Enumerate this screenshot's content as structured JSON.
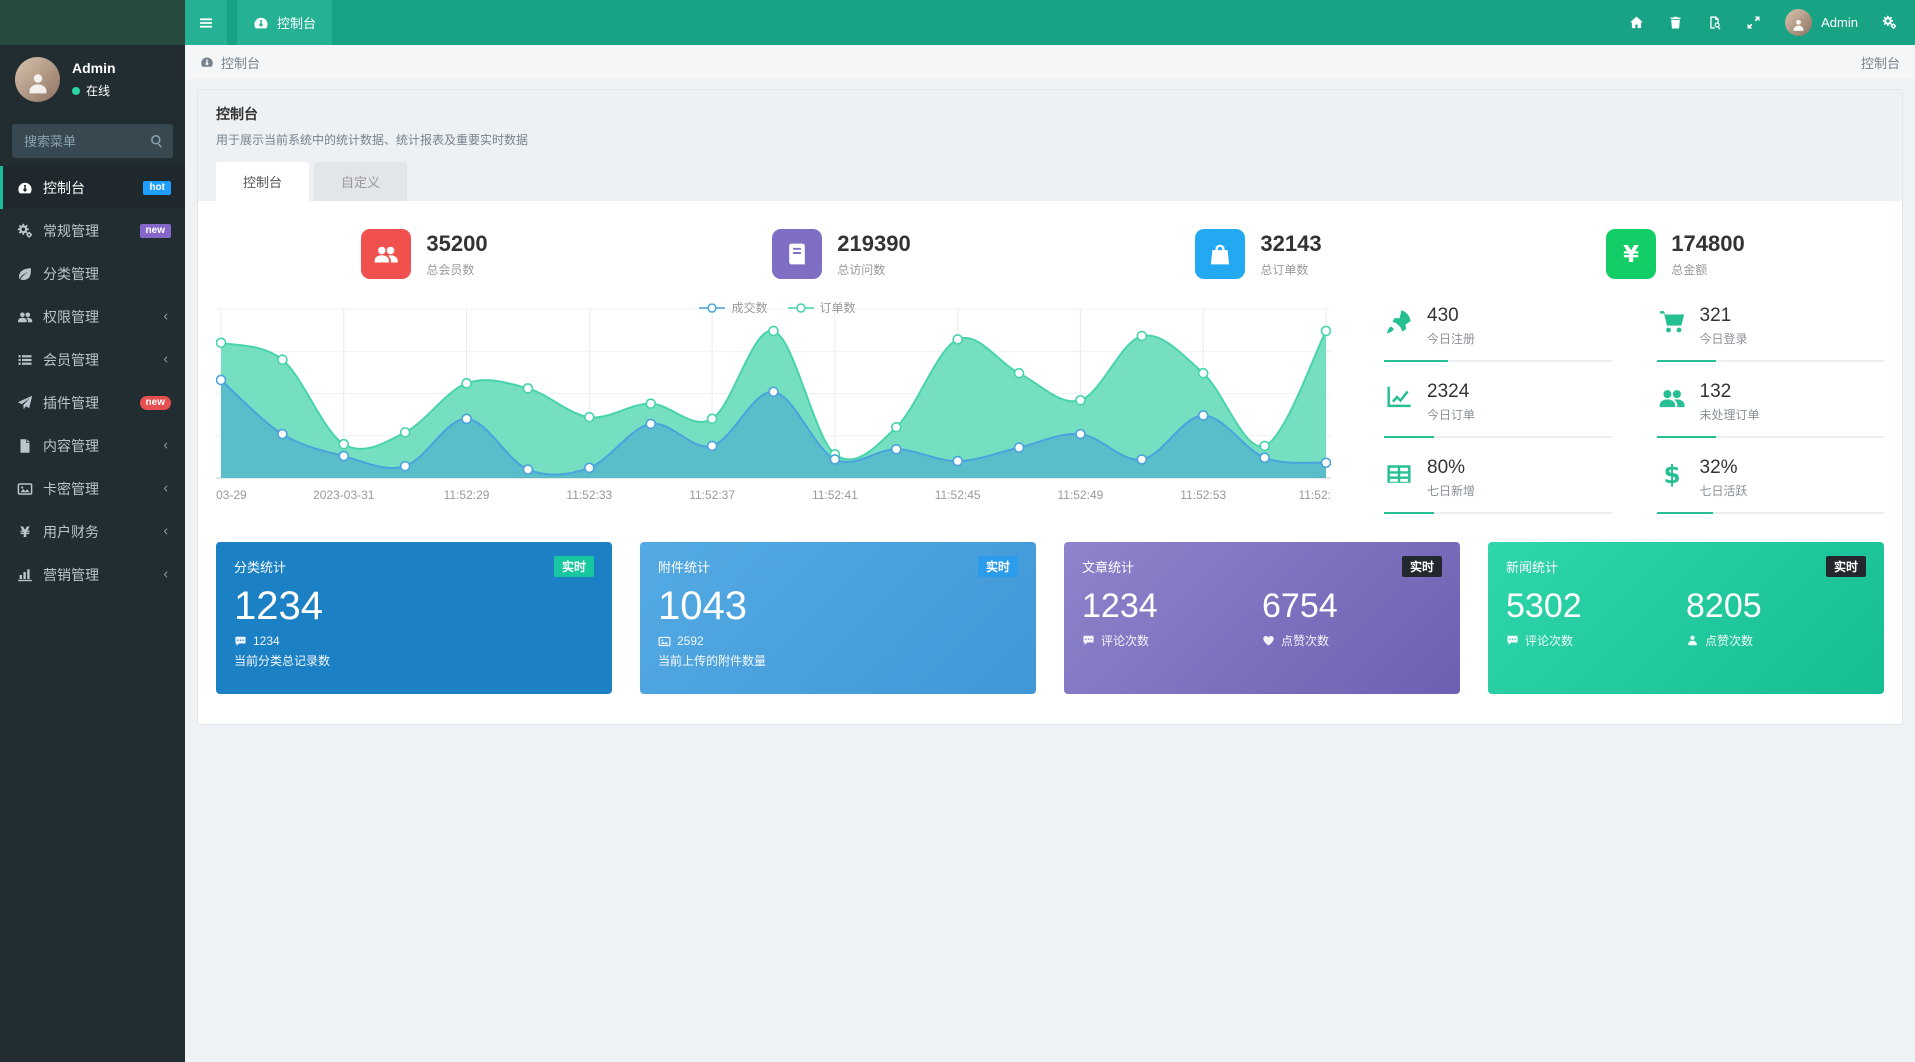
{
  "colors": {
    "navbar_bg": "#19a385",
    "navbar_tile": "#25b294",
    "sidebar_bg": "#222d32",
    "page_bg": "#eff2f5",
    "accent_green": "#26bf94"
  },
  "navbar": {
    "active_tab": {
      "icon": "gauge",
      "label": "控制台"
    },
    "right_icons": [
      {
        "icon": "home"
      },
      {
        "icon": "trash"
      },
      {
        "icon": "file-search"
      },
      {
        "icon": "expand"
      }
    ],
    "user": {
      "name": "Admin"
    }
  },
  "sidebar": {
    "user": {
      "name": "Admin",
      "status": "在线"
    },
    "search_placeholder": "搜索菜单",
    "items": [
      {
        "id": "dashboard",
        "icon": "gauge",
        "label": "控制台",
        "active": true,
        "badge": {
          "text": "hot",
          "color": "#1E9FFF",
          "shape": "square"
        }
      },
      {
        "id": "general",
        "icon": "cogs",
        "label": "常规管理",
        "badge": {
          "text": "new",
          "color": "#8666c8",
          "shape": "square"
        }
      },
      {
        "id": "category",
        "icon": "leaf",
        "label": "分类管理"
      },
      {
        "id": "auth",
        "icon": "users",
        "label": "权限管理",
        "arrow": true
      },
      {
        "id": "member",
        "icon": "list",
        "label": "会员管理",
        "arrow": true
      },
      {
        "id": "addon",
        "icon": "plane",
        "label": "插件管理",
        "badge": {
          "text": "new",
          "color": "#e8504f",
          "shape": "pill"
        }
      },
      {
        "id": "content",
        "icon": "file",
        "label": "内容管理",
        "arrow": true
      },
      {
        "id": "cardkey",
        "icon": "image",
        "label": "卡密管理",
        "arrow": true
      },
      {
        "id": "finance",
        "icon": "yen",
        "label": "用户财务",
        "arrow": true
      },
      {
        "id": "marketing",
        "icon": "chart-bar",
        "label": "营销管理",
        "arrow": true
      }
    ]
  },
  "breadcrumb": {
    "left": "控制台",
    "right": "控制台"
  },
  "panel": {
    "title": "控制台",
    "description": "用于展示当前系统中的统计数据、统计报表及重要实时数据",
    "tabs": [
      {
        "label": "控制台",
        "active": true
      },
      {
        "label": "自定义",
        "active": false
      }
    ]
  },
  "stats": [
    {
      "icon": "users",
      "color": "#f0514f",
      "value": "35200",
      "label": "总会员数"
    },
    {
      "icon": "book",
      "color": "#7f6ec4",
      "value": "219390",
      "label": "总访问数"
    },
    {
      "icon": "bag",
      "color": "#23a8f2",
      "value": "32143",
      "label": "总订单数"
    },
    {
      "icon": "yen",
      "color": "#13ce66",
      "value": "174800",
      "label": "总金额"
    }
  ],
  "chart_data": {
    "type": "area",
    "title": "",
    "smooth": true,
    "markers": true,
    "grid": true,
    "legend_position": "top-center",
    "legend": [
      "成交数",
      "订单数"
    ],
    "x_tick_labels": [
      "03-29",
      "2023-03-31",
      "11:52:29",
      "11:52:33",
      "11:52:37",
      "11:52:41",
      "11:52:45",
      "11:52:49",
      "11:52:53",
      "11:52:"
    ],
    "x_tick_indices": [
      0,
      2,
      4,
      6,
      8,
      10,
      12,
      14,
      16,
      18
    ],
    "ylim": [
      0,
      100
    ],
    "series": [
      {
        "name": "成交数",
        "color": "#4aa3dd",
        "fill": "rgba(62,155,212,0.5)",
        "values": [
          58,
          26,
          13,
          7,
          35,
          5,
          6,
          32,
          19,
          51,
          11,
          17,
          10,
          18,
          26,
          11,
          37,
          12,
          9
        ]
      },
      {
        "name": "订单数",
        "color": "#47d4ac",
        "fill": "rgba(95,217,182,0.85)",
        "values": [
          80,
          70,
          20,
          27,
          56,
          53,
          36,
          44,
          35,
          87,
          14,
          30,
          82,
          62,
          46,
          84,
          62,
          19,
          87
        ]
      }
    ]
  },
  "ministats": [
    {
      "icon": "rocket",
      "value": "430",
      "label": "今日注册",
      "progress": 28
    },
    {
      "icon": "cart",
      "value": "321",
      "label": "今日登录",
      "progress": 26
    },
    {
      "icon": "line-chart",
      "value": "2324",
      "label": "今日订单",
      "progress": 22
    },
    {
      "icon": "users",
      "value": "132",
      "label": "未处理订单",
      "progress": 26
    },
    {
      "icon": "table",
      "value": "80%",
      "label": "七日新增",
      "progress": 22
    },
    {
      "icon": "dollar",
      "value": "32%",
      "label": "七日活跃",
      "progress": 25
    }
  ],
  "cards": [
    {
      "id": "category-stats",
      "title": "分类统计",
      "badge": "实时",
      "badge_bg": "#16c7a0",
      "bg": "#1b80c4",
      "bg2": "#1b80c4",
      "columns": [
        {
          "value": "1234",
          "icon": "comment",
          "sub": "1234",
          "caption": "当前分类总记录数"
        }
      ]
    },
    {
      "id": "attachment-stats",
      "title": "附件统计",
      "badge": "实时",
      "badge_bg": "#2a9ceb",
      "bg": "#55aae3",
      "bg2": "#3f97d6",
      "columns": [
        {
          "value": "1043",
          "icon": "image",
          "sub": "2592",
          "caption": "当前上传的附件数量"
        }
      ]
    },
    {
      "id": "article-stats",
      "title": "文章统计",
      "badge": "实时",
      "badge_bg": "#23282e",
      "bg": "#8d84cc",
      "bg2": "#6d60b2",
      "columns": [
        {
          "value": "1234",
          "icon": "comment",
          "sub": "评论次数"
        },
        {
          "value": "6754",
          "icon": "heart",
          "sub": "点赞次数"
        }
      ]
    },
    {
      "id": "news-stats",
      "title": "新闻统计",
      "badge": "实时",
      "badge_bg": "#23282e",
      "bg": "#2fd6ab",
      "bg2": "#17bd92",
      "columns": [
        {
          "value": "5302",
          "icon": "comment",
          "sub": "评论次数"
        },
        {
          "value": "8205",
          "icon": "person",
          "sub": "点赞次数"
        }
      ]
    }
  ]
}
